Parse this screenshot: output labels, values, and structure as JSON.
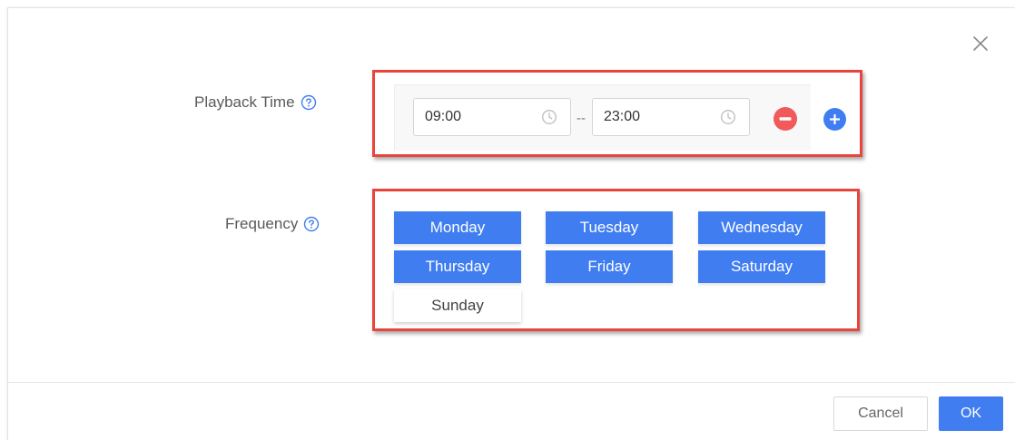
{
  "playback": {
    "label": "Playback Time",
    "start_time": "09:00",
    "separator": "--",
    "end_time": "23:00"
  },
  "frequency": {
    "label": "Frequency",
    "days": [
      {
        "label": "Monday",
        "selected": true
      },
      {
        "label": "Tuesday",
        "selected": true
      },
      {
        "label": "Wednesday",
        "selected": true
      },
      {
        "label": "Thursday",
        "selected": true
      },
      {
        "label": "Friday",
        "selected": true
      },
      {
        "label": "Saturday",
        "selected": true
      },
      {
        "label": "Sunday",
        "selected": false
      }
    ]
  },
  "footer": {
    "cancel_label": "Cancel",
    "ok_label": "OK"
  },
  "icons": {
    "close": "close-icon",
    "help": "help-circle-icon",
    "clock": "clock-icon",
    "remove": "minus-circle-icon",
    "add": "plus-circle-icon"
  },
  "colors": {
    "accent": "#3f7df1",
    "remove": "#f05a5a",
    "highlight": "#e8453c"
  }
}
